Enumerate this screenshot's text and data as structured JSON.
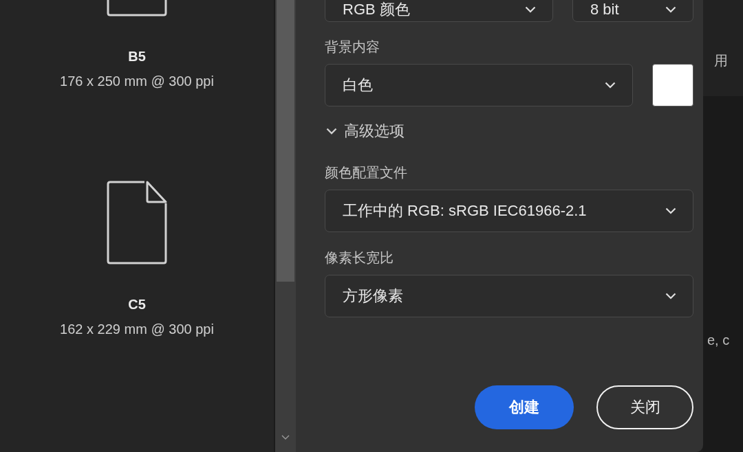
{
  "presets": [
    {
      "name": "B5",
      "size": "176 x 250 mm @ 300 ppi"
    },
    {
      "name": "C5",
      "size": "162 x 229 mm @ 300 ppi"
    }
  ],
  "mode_row": [
    {
      "value": "RGB 颜色"
    },
    {
      "value": "8 bit"
    }
  ],
  "background": {
    "label": "背景内容",
    "value": "白色",
    "color": "#ffffff"
  },
  "advanced": {
    "label": "高级选项",
    "expanded": true,
    "fields": [
      {
        "label": "颜色配置文件",
        "value": "工作中的 RGB: sRGB IEC61966-2.1"
      },
      {
        "label": "像素长宽比",
        "value": "方形像素"
      }
    ]
  },
  "buttons": [
    {
      "label": "创建",
      "kind": "primary"
    },
    {
      "label": "关闭",
      "kind": "secondary"
    }
  ],
  "behind_window": {
    "texts": [
      "用",
      "e, c"
    ]
  }
}
